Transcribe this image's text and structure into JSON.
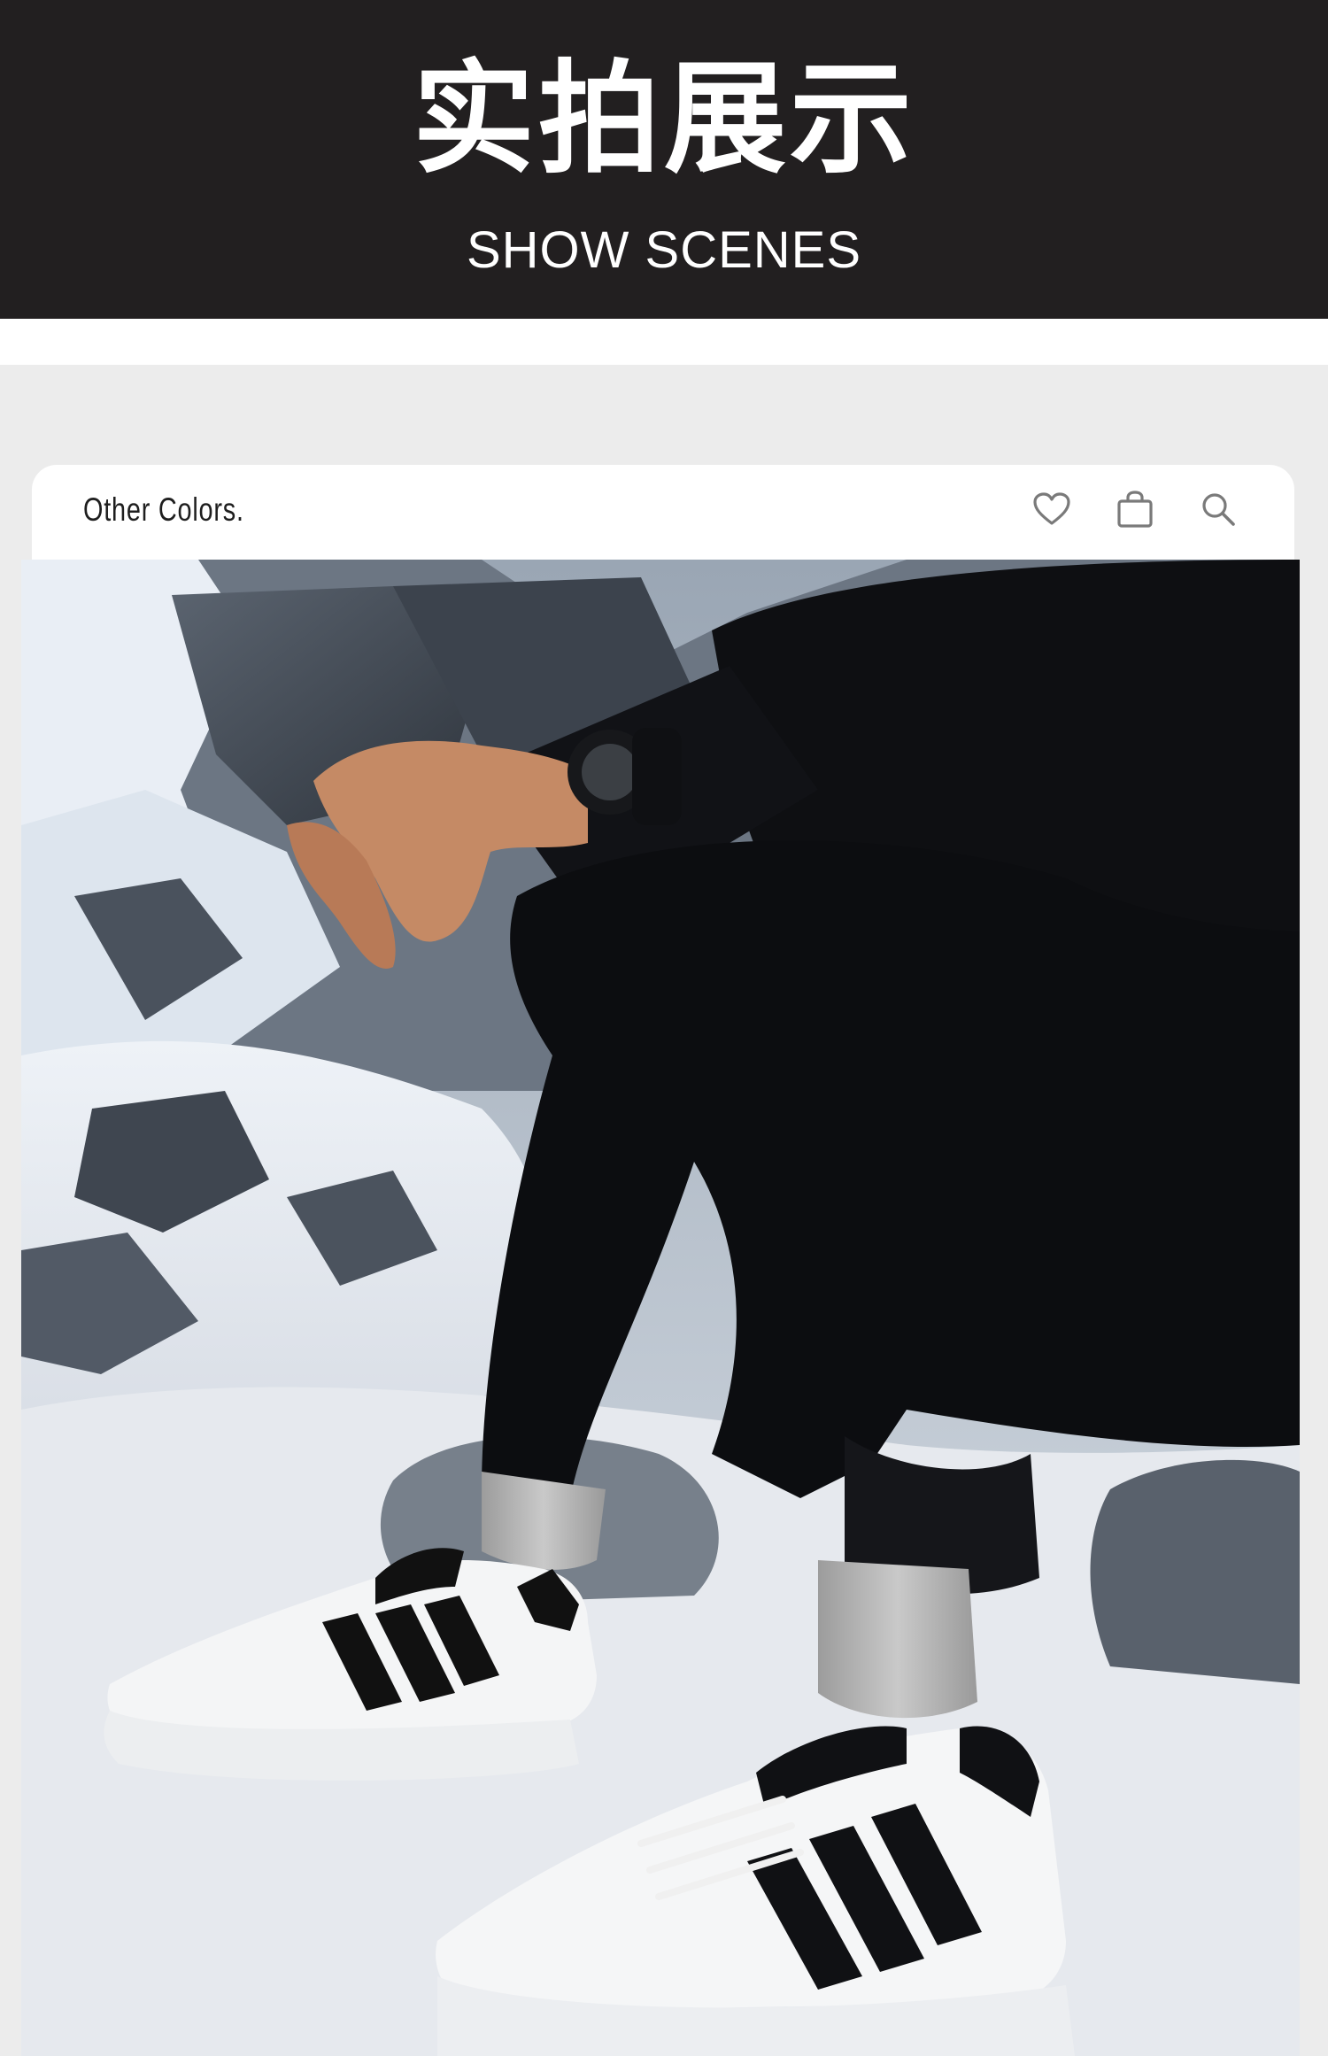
{
  "header": {
    "title": "实拍展示",
    "subtitle": "SHOW SCENES"
  },
  "card": {
    "label": "Other Colors.",
    "icons": [
      "heart-icon",
      "shopping-bag-icon",
      "search-icon"
    ]
  },
  "photo": {
    "subject": "sneaker-lifestyle-photo"
  },
  "colors": {
    "header_bg": "#221f20",
    "page_bg": "#ececec",
    "card_bg": "#ffffff"
  }
}
